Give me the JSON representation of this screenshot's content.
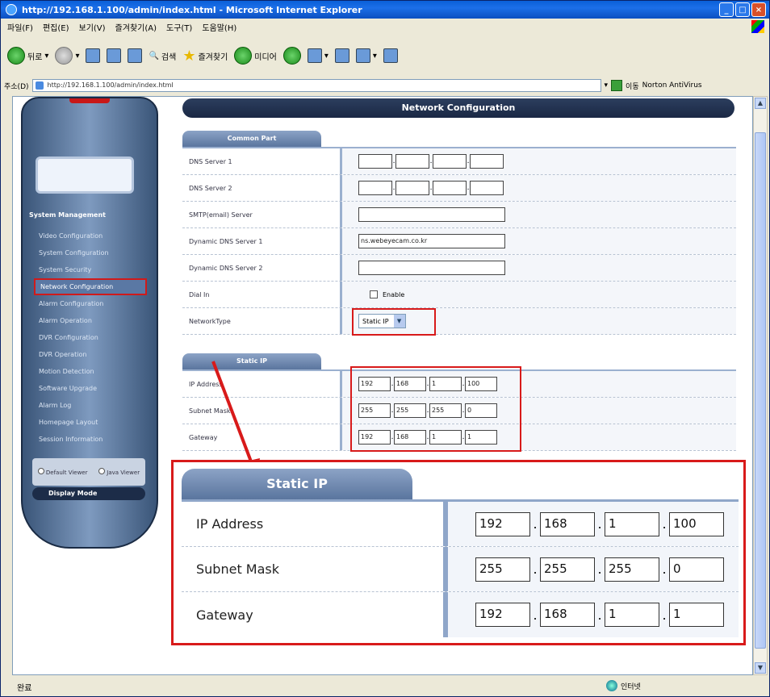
{
  "window": {
    "title": "http://192.168.1.100/admin/index.html - Microsoft Internet Explorer",
    "address": "http://192.168.1.100/admin/index.html",
    "menu": [
      "파일(F)",
      "편집(E)",
      "보기(V)",
      "즐겨찾기(A)",
      "도구(T)",
      "도움말(H)"
    ],
    "toolbar": [
      "뒤로",
      "검색",
      "즐겨찾기",
      "미디어"
    ],
    "status": "완료",
    "zone": "인터넷"
  },
  "nav": {
    "title": "System Management",
    "items": [
      "Video Configuration",
      "System Configuration",
      "System Security",
      "Network Configuration",
      "Alarm Configuration",
      "Alarm Operation",
      "DVR Configuration",
      "DVR Operation",
      "Motion Detection",
      "Software Upgrade",
      "Alarm Log",
      "Homepage Layout",
      "Session Information"
    ],
    "viewer_default": "Default Viewer",
    "viewer_java": "Java Viewer",
    "display_mode": "Display Mode"
  },
  "page": {
    "title": "Network Configuration",
    "common_part": {
      "tab": "Common Part",
      "dns1_label": "DNS Server 1",
      "dns2_label": "DNS Server 2",
      "smtp_label": "SMTP(email) Server",
      "ddns1_label": "Dynamic DNS Server 1",
      "ddns1_value": "ns.webeyecam.co.kr",
      "ddns2_label": "Dynamic DNS Server 2",
      "dialin_label": "Dial In",
      "dialin_enable": "Enable",
      "nettype_label": "NetworkType",
      "nettype_value": "Static IP"
    },
    "static_ip": {
      "tab": "Static IP",
      "ip_label": "IP Address",
      "ip": [
        "192",
        "168",
        "1",
        "100"
      ],
      "mask_label": "Subnet Mask",
      "mask": [
        "255",
        "255",
        "255",
        "0"
      ],
      "gw_label": "Gateway",
      "gw": [
        "192",
        "168",
        "1",
        "1"
      ]
    }
  }
}
